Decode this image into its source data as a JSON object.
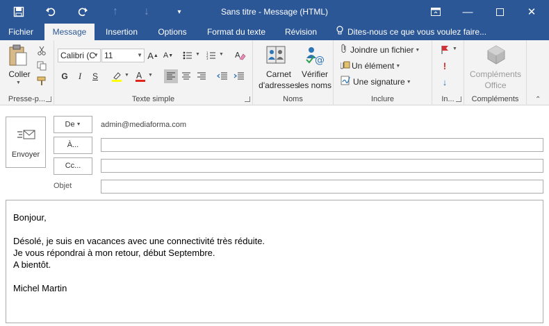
{
  "window": {
    "title": "Sans titre - Message (HTML)"
  },
  "tabs": [
    {
      "label": "Fichier"
    },
    {
      "label": "Message"
    },
    {
      "label": "Insertion"
    },
    {
      "label": "Options"
    },
    {
      "label": "Format du texte"
    },
    {
      "label": "Révision"
    }
  ],
  "tell_me": "Dites-nous ce que vous voulez faire...",
  "ribbon": {
    "clipboard": {
      "paste_label": "Coller",
      "group_label": "Presse-p..."
    },
    "basic_text": {
      "font_name": "Calibri (C",
      "font_size": "11",
      "bold": "G",
      "italic": "I",
      "underline": "S",
      "group_label": "Texte simple"
    },
    "names": {
      "address_book_line1": "Carnet",
      "address_book_line2": "d'adresses",
      "check_names_line1": "Vérifier",
      "check_names_line2": "les noms",
      "group_label": "Noms"
    },
    "include": {
      "attach_file": "Joindre un fichier",
      "attach_item": "Un élément",
      "signature": "Une signature",
      "group_label": "Inclure"
    },
    "tags": {
      "group_label": "In..."
    },
    "addins": {
      "label_line1": "Compléments",
      "label_line2": "Office",
      "group_label": "Compléments"
    }
  },
  "compose": {
    "send_label": "Envoyer",
    "from_label": "De",
    "from_address": "admin@mediaforma.com",
    "to_label": "À...",
    "cc_label": "Cc...",
    "subject_label": "Objet",
    "to_value": "",
    "cc_value": "",
    "subject_value": "",
    "body_lines": [
      "Bonjour,",
      "",
      "Désolé, je suis en vacances avec une connectivité très réduite.",
      "Je vous répondrai à mon retour, début Septembre.",
      "A bientôt.",
      "",
      "Michel Martin"
    ]
  },
  "colors": {
    "title_bar": "#2b5797",
    "ribbon_bg": "#f3f3f3",
    "highlight_yellow": "#ffff00",
    "font_red": "#e0241b",
    "flag_red": "#d13438",
    "arrow_blue": "#2e75b6"
  }
}
